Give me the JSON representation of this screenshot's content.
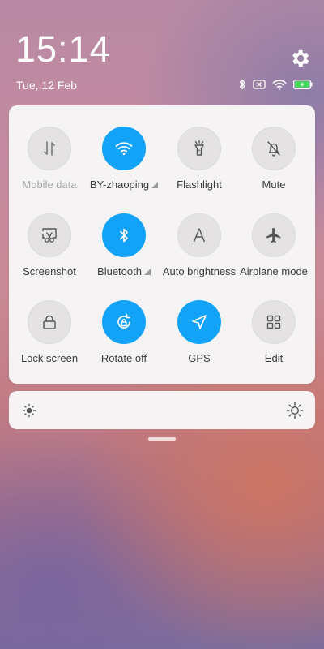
{
  "status_bar": {
    "time": "15:14",
    "date": "Tue, 12 Feb",
    "icons": [
      "bluetooth-icon",
      "no-sim-icon",
      "wifi-icon",
      "battery-charging-icon"
    ]
  },
  "quick_settings": {
    "tiles": [
      {
        "id": "mobile-data",
        "label": "Mobile data",
        "icon": "mobile-data-icon",
        "active": false,
        "disabled": true
      },
      {
        "id": "wifi",
        "label": "BY-zhaoping",
        "icon": "wifi-icon",
        "active": true,
        "has_expand": true
      },
      {
        "id": "flashlight",
        "label": "Flashlight",
        "icon": "flashlight-icon",
        "active": false
      },
      {
        "id": "mute",
        "label": "Mute",
        "icon": "bell-off-icon",
        "active": false
      },
      {
        "id": "screenshot",
        "label": "Screenshot",
        "icon": "screenshot-icon",
        "active": false
      },
      {
        "id": "bluetooth",
        "label": "Bluetooth",
        "icon": "bluetooth-icon",
        "active": true,
        "has_expand": true
      },
      {
        "id": "auto-brightness",
        "label": "Auto brightness",
        "icon": "auto-brightness-icon",
        "active": false
      },
      {
        "id": "airplane-mode",
        "label": "Airplane mode",
        "icon": "airplane-icon",
        "active": false
      },
      {
        "id": "lock-screen",
        "label": "Lock screen",
        "icon": "lock-icon",
        "active": false
      },
      {
        "id": "rotate-off",
        "label": "Rotate off",
        "icon": "rotation-lock-icon",
        "active": true
      },
      {
        "id": "gps",
        "label": "GPS",
        "icon": "location-arrow-icon",
        "active": true
      },
      {
        "id": "edit",
        "label": "Edit",
        "icon": "grid-icon",
        "active": false
      }
    ]
  },
  "brightness": {
    "low_icon": "sun-small-icon",
    "high_icon": "sun-large-icon",
    "level": 0
  },
  "colors": {
    "accent": "#12a3f8",
    "tile_off": "#e4e2e3",
    "panel": "#f5f3f4"
  }
}
